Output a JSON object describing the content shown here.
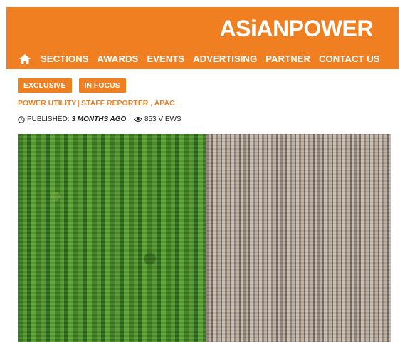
{
  "header": {
    "logo_text": "ASiANPOWER",
    "brand_color": "#f07f22",
    "nav_items": [
      "SECTIONS",
      "AWARDS",
      "EVENTS",
      "ADVERTISING",
      "PARTNER",
      "CONTACT US"
    ]
  },
  "article": {
    "tags": [
      "EXCLUSIVE",
      "IN FOCUS"
    ],
    "category": "POWER UTILITY",
    "author": "STAFF REPORTER , APAC",
    "published_label": "PUBLISHED:",
    "published_ago": "3 MONTHS AGO",
    "views": "853 VIEWS"
  },
  "icons": {
    "home": "home-icon",
    "clock": "clock-icon",
    "eye": "eye-icon"
  }
}
